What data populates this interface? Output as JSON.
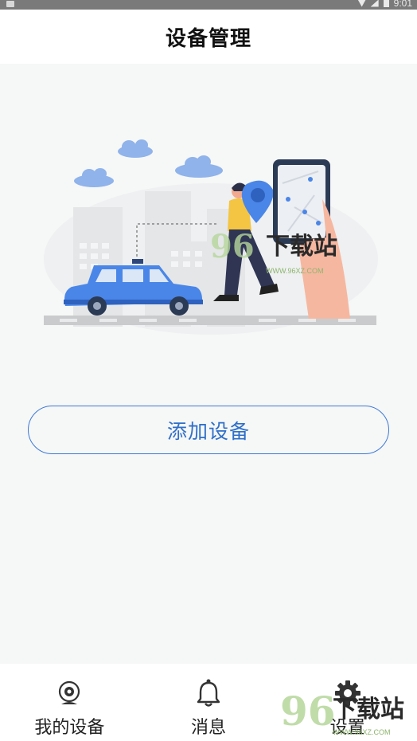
{
  "status_bar": {
    "time": "9:01"
  },
  "header": {
    "title": "设备管理"
  },
  "main": {
    "add_button_label": "添加设备"
  },
  "watermark": {
    "brand": "下载站",
    "number": "96",
    "url": "WWW.96XZ.COM"
  },
  "tabs": [
    {
      "label": "我的设备",
      "icon": "camera-icon"
    },
    {
      "label": "消息",
      "icon": "bell-icon"
    },
    {
      "label": "设置",
      "icon": "gear-icon"
    }
  ],
  "colors": {
    "accent": "#2f6fc9",
    "car": "#4a86e8",
    "background": "#f6f7f7"
  }
}
